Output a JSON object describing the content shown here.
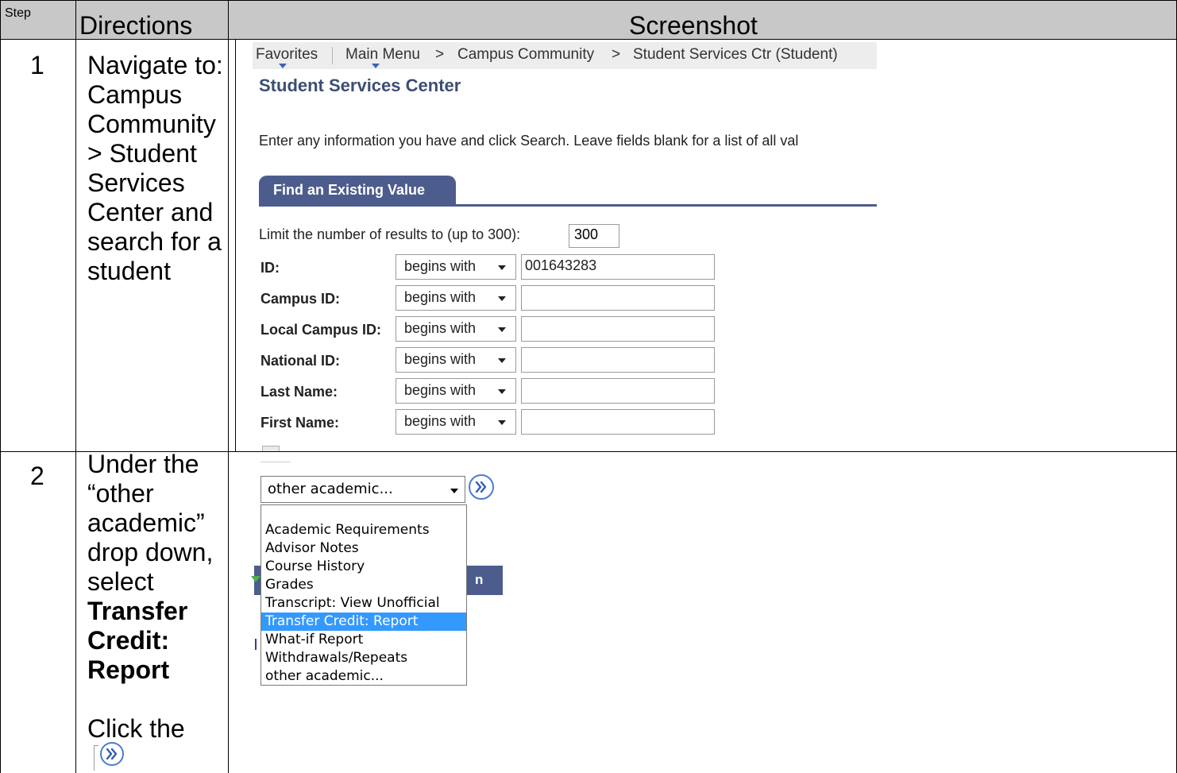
{
  "table": {
    "headers": {
      "step": "Step",
      "directions": "Directions",
      "screenshot": "Screenshot"
    }
  },
  "rows": [
    {
      "step": "1",
      "directions": [
        "Navigate to:",
        "Campus",
        "Community",
        "> Student",
        "Services",
        "Center and",
        "search for a",
        "student"
      ]
    },
    {
      "step": "2",
      "directions": [
        "Under the",
        "“other",
        "academic”",
        "drop down,",
        "select"
      ],
      "bold": [
        "Transfer",
        "Credit:",
        "Report"
      ],
      "click": "Click the"
    }
  ],
  "screenshot1": {
    "breadcrumbs": [
      "Favorites",
      "Main Menu",
      ">",
      "Campus Community",
      ">",
      "Student Services Ctr (Student)"
    ],
    "title": "Student Services Center",
    "instructions": "Enter any information you have and click Search. Leave fields blank for a list of all val",
    "tab": "Find an Existing Value",
    "limit_label": "Limit the number of results to (up to 300):",
    "limit_value": "300",
    "fields": [
      {
        "label": "ID:",
        "operator": "begins with",
        "value": "001643283"
      },
      {
        "label": "Campus ID:",
        "operator": "begins with",
        "value": ""
      },
      {
        "label": "Local Campus ID:",
        "operator": "begins with",
        "value": ""
      },
      {
        "label": "National ID:",
        "operator": "begins with",
        "value": ""
      },
      {
        "label": "Last Name:",
        "operator": "begins with",
        "value": ""
      },
      {
        "label": "First Name:",
        "operator": "begins with",
        "value": ""
      }
    ]
  },
  "screenshot2": {
    "dropdown_value": "other academic...",
    "bar_text": "n",
    "options": [
      "Academic Requirements",
      "Advisor Notes",
      "Course History",
      "Grades",
      "Transcript: View Unofficial",
      "Transfer Credit: Report",
      "What-if Report",
      "Withdrawals/Repeats",
      "other academic..."
    ],
    "selected_index": 5
  },
  "icons": {
    "go": "double-chevron-right-circle-icon"
  },
  "colors": {
    "header_bg": "#c8c8c8",
    "tab_blue": "#4c5d8d",
    "title_blue": "#3b4e74",
    "selected_option": "#3399ff"
  }
}
